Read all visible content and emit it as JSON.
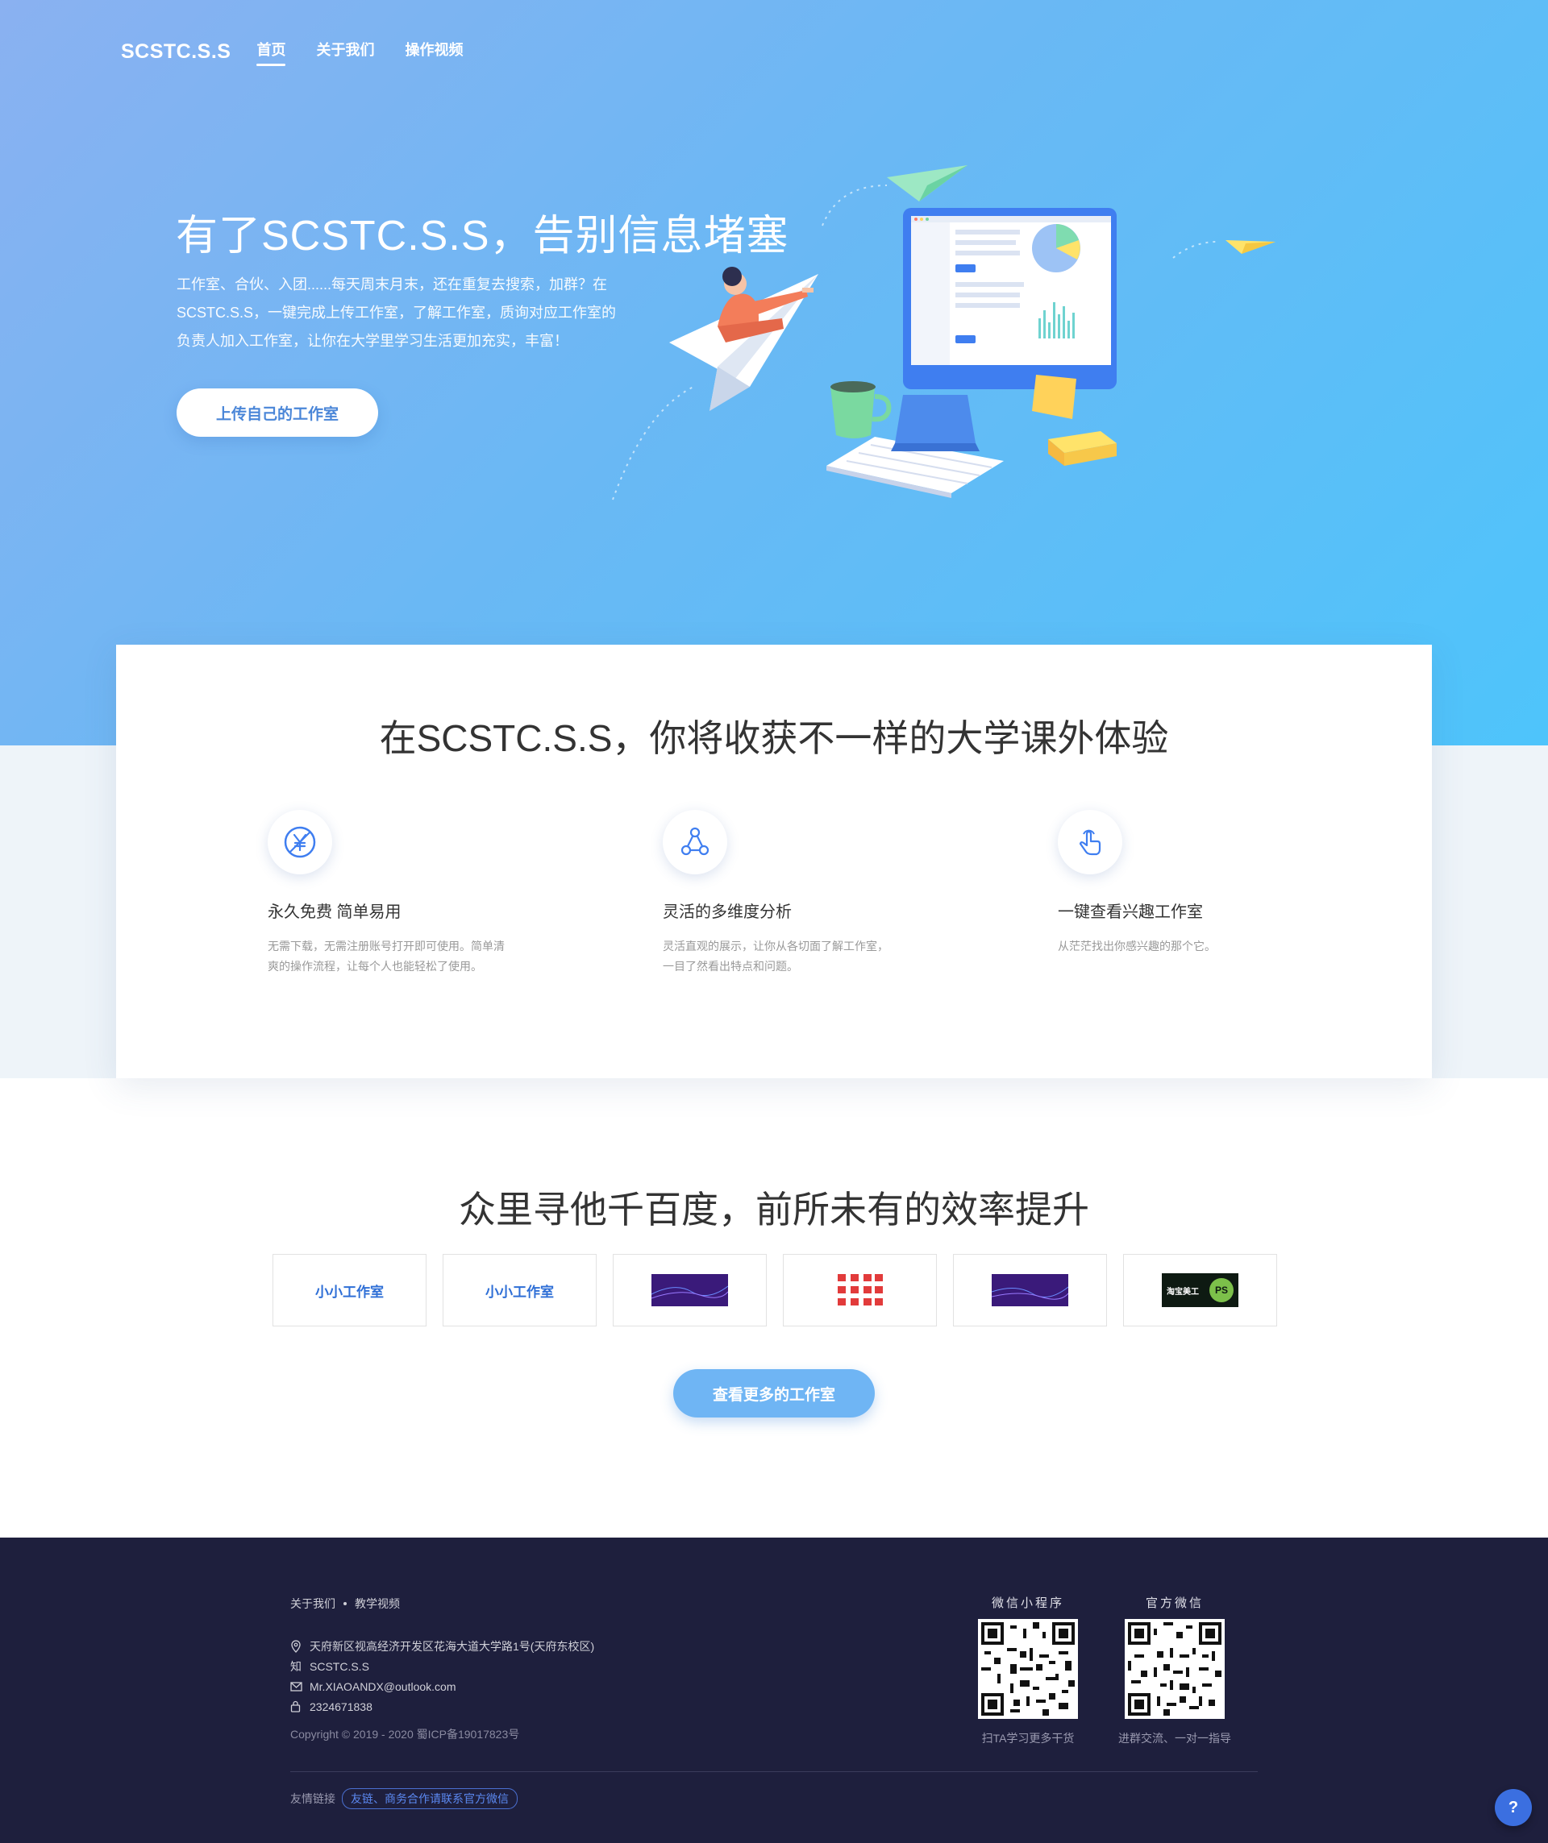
{
  "nav": {
    "brand": "SCSTC.S.S",
    "links": [
      "首页",
      "关于我们",
      "操作视频"
    ]
  },
  "hero": {
    "title": "有了SCSTC.S.S，告别信息堵塞",
    "desc": "工作室、合伙、入团......每天周末月末，还在重复去搜索，加群？在SCSTC.S.S，一键完成上传工作室，了解工作室，质询对应工作室的负责人加入工作室，让你在大学里学习生活更加充实，丰富！",
    "button": "上传自己的工作室"
  },
  "features": {
    "title": "在SCSTC.S.S，你将收获不一样的大学课外体验",
    "items": [
      {
        "name": "永久免费 简单易用",
        "text": "无需下载，无需注册账号打开即可使用。简单清爽的操作流程，让每个人也能轻松了使用。",
        "icon": "yen-icon"
      },
      {
        "name": "灵活的多维度分析",
        "text": "灵活直观的展示，让你从各切面了解工作室，一目了然看出特点和问题。",
        "icon": "network-icon"
      },
      {
        "name": "一键查看兴趣工作室",
        "text": "从茫茫找出你感兴趣的那个它。",
        "icon": "pointer-hand-icon"
      }
    ]
  },
  "studios": {
    "title": "众里寻他千百度，前所未有的效率提升",
    "items": [
      "小小工作室",
      "小小工作室",
      "",
      "",
      "",
      "淘宝美工"
    ],
    "button": "查看更多的工作室"
  },
  "footer": {
    "links": [
      "关于我们",
      "教学视频"
    ],
    "address": "天府新区视高经济开发区花海大道大学路1号(天府东校区)",
    "zhihu_label": "知",
    "zhihu": "SCSTC.S.S",
    "email": "Mr.XIAOANDX@outlook.com",
    "phone": "2324671838",
    "copyright": "Copyright © 2019 - 2020 蜀ICP备19017823号",
    "friend_label": "友情链接",
    "friend_tag": "友链、商务合作请联系官方微信",
    "qr": [
      {
        "title": "微信小程序",
        "caption": "扫TA学习更多干货"
      },
      {
        "title": "官方微信",
        "caption": "进群交流、一对一指导"
      }
    ]
  },
  "help": {
    "label": "?"
  },
  "colors": {
    "hero_start": "#8ab1f1",
    "hero_end": "#4ec4fb",
    "accent": "#4a86d8",
    "footer_bg": "#1e1f3d"
  }
}
